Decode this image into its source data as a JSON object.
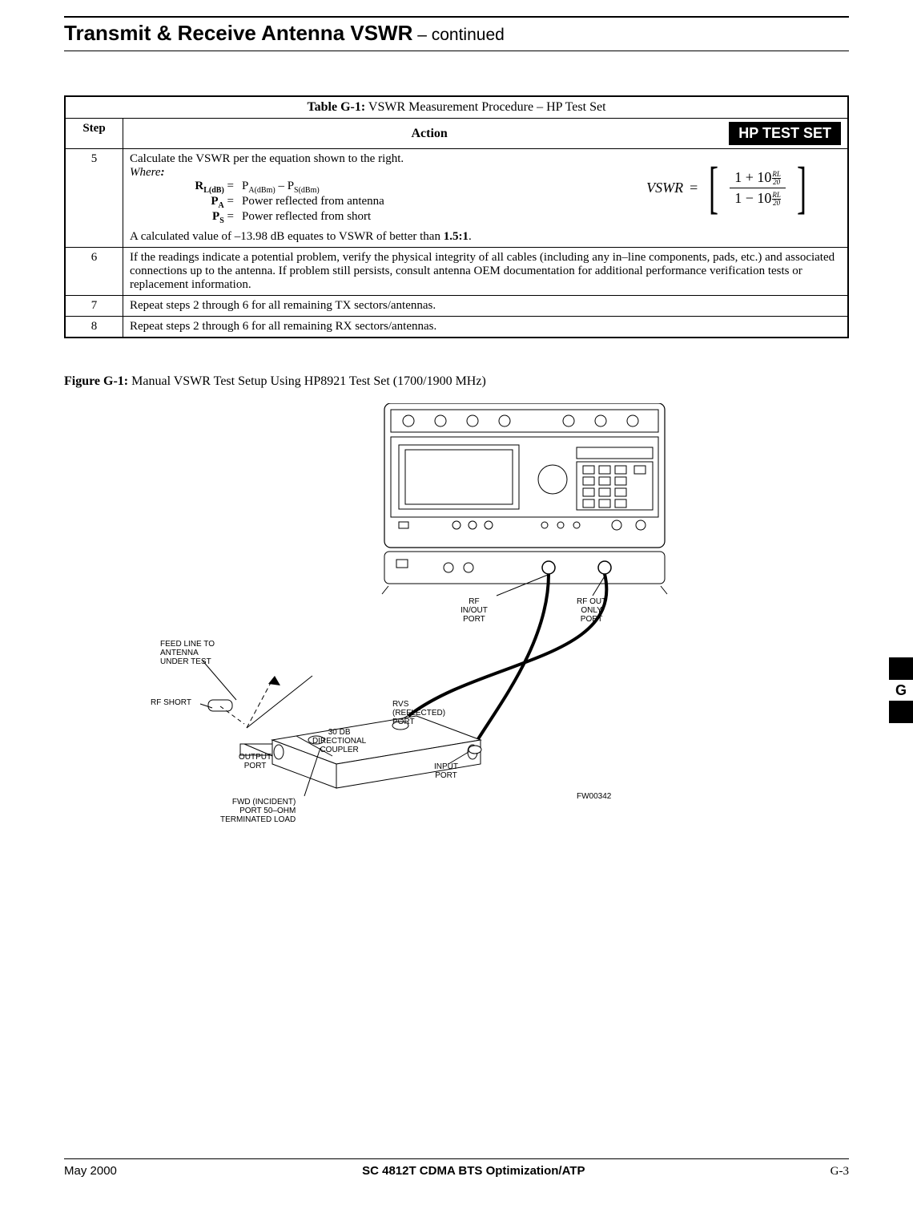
{
  "header": {
    "title_main": "Transmit & Receive Antenna VSWR",
    "title_cont": " – continued"
  },
  "table": {
    "title_bold": "Table G-1:",
    "title_rest": " VSWR Measurement Procedure – HP Test Set",
    "col_step": "Step",
    "col_action": "Action",
    "badge": "HP TEST SET",
    "step5": {
      "num": "5",
      "line1": "Calculate the VSWR per the equation shown to the right.",
      "where": "Where",
      "colon": ":",
      "rl_key_pre": "R",
      "rl_key_sub": "L(dB)",
      "rl_key_eq": " = ",
      "rl_val_pre": "P",
      "rl_val_sub1": "A(dBm)",
      "rl_minus": " – P",
      "rl_val_sub2": "S(dBm)",
      "pa_key_pre": "P",
      "pa_key_sub": "A",
      "pa_key_eq": " = ",
      "pa_val": "Power reflected from antenna",
      "ps_key_pre": "P",
      "ps_key_sub": "S",
      "ps_key_eq": " = ",
      "ps_val": "Power reflected from short",
      "calc_pre": "A calculated value of  –13.98 dB equates to VSWR of better than ",
      "calc_bold": "1.5:1",
      "calc_post": ".",
      "eq_vswr": "VSWR",
      "eq_eq": "=",
      "eq_num": "1 + 10",
      "eq_den": "1 − 10",
      "eq_rl": "RL",
      "eq_20": "20"
    },
    "step6": {
      "num": "6",
      "text": "If the readings indicate a potential problem, verify the physical integrity of all cables (including any in–line components, pads, etc.) and associated connections up to the antenna. If problem still persists, consult antenna OEM documentation for additional performance verification tests or replacement information."
    },
    "step7": {
      "num": "7",
      "text": "Repeat steps 2 through 6 for all remaining TX sectors/antennas."
    },
    "step8": {
      "num": "8",
      "text": "Repeat steps 2 through 6 for all remaining RX sectors/antennas."
    }
  },
  "figure": {
    "caption_bold": "Figure G-1:",
    "caption_rest": " Manual VSWR Test Setup Using HP8921 Test Set (1700/1900 MHz)",
    "labels": {
      "rf_inout": "RF\nIN/OUT\nPORT",
      "rf_out_only": "RF OUT\nONLY\nPORT",
      "feed_line": "FEED LINE TO\nANTENNA\nUNDER TEST",
      "rf_short": "RF SHORT",
      "rvs": "RVS\n(REFLECTED)\nPORT",
      "coupler": "30 DB\nDIRECTIONAL\nCOUPLER",
      "output_port": "OUTPUT\nPORT",
      "input_port": "INPUT\nPORT",
      "fwd": "FWD (INCIDENT)\nPORT 50–OHM\nTERMINATED LOAD",
      "code": "FW00342"
    }
  },
  "side_tab": "G",
  "footer": {
    "left": "May 2000",
    "center": "SC 4812T CDMA BTS Optimization/ATP",
    "right": "G-3"
  }
}
